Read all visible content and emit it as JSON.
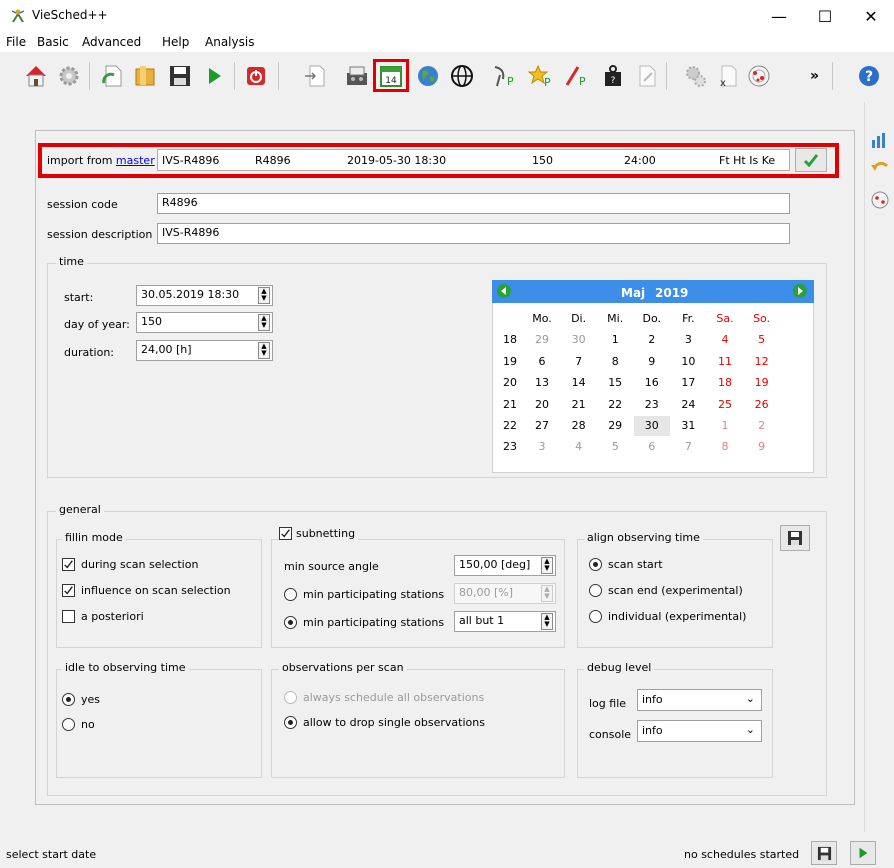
{
  "window": {
    "title": "VieSched++",
    "minimize": "—",
    "maximize": "☐",
    "close": "✕"
  },
  "menu": [
    "File",
    "Basic",
    "Advanced",
    "Help",
    "Analysis"
  ],
  "toolbar": {
    "overflow": "»"
  },
  "import": {
    "label": "import from",
    "link": "master",
    "fields": [
      "IVS-R4896",
      "R4896",
      "2019-05-30 18:30",
      "150",
      "24:00",
      "Ft Ht Is Ke"
    ]
  },
  "session": {
    "code_label": "session code",
    "code_value": "R4896",
    "desc_label": "session description",
    "desc_value": "IVS-R4896"
  },
  "time": {
    "group": "time",
    "start_label": "start:",
    "start_value": "30.05.2019 18:30",
    "doy_label": "day of year:",
    "doy_value": "150",
    "duration_label": "duration:",
    "duration_value": "24,00 [h]"
  },
  "calendar": {
    "month": "Maj",
    "year": "2019",
    "weekdays": [
      "Mo.",
      "Di.",
      "Mi.",
      "Do.",
      "Fr.",
      "Sa.",
      "So."
    ],
    "weeks": [
      "18",
      "19",
      "20",
      "21",
      "22",
      "23"
    ],
    "days": [
      [
        "29",
        "30",
        "1",
        "2",
        "3",
        "4",
        "5"
      ],
      [
        "6",
        "7",
        "8",
        "9",
        "10",
        "11",
        "12"
      ],
      [
        "13",
        "14",
        "15",
        "16",
        "17",
        "18",
        "19"
      ],
      [
        "20",
        "21",
        "22",
        "23",
        "24",
        "25",
        "26"
      ],
      [
        "27",
        "28",
        "29",
        "30",
        "31",
        "1",
        "2"
      ],
      [
        "3",
        "4",
        "5",
        "6",
        "7",
        "8",
        "9"
      ]
    ]
  },
  "general": {
    "group": "general",
    "fillin": {
      "title": "fillin mode",
      "opt1": "during scan selection",
      "opt2": "influence on scan selection",
      "opt3": "a posteriori"
    },
    "subnet": {
      "title": "subnetting",
      "angle_label": "min source angle",
      "angle_value": "150,00 [deg]",
      "min_pct_label": "min participating stations",
      "min_pct_value": "80,00 [%]",
      "min_sta_label": "min participating stations",
      "min_sta_value": "all but 1"
    },
    "align": {
      "title": "align observing time",
      "opt1": "scan start",
      "opt2": "scan end (experimental)",
      "opt3": "individual (experimental)"
    },
    "idle": {
      "title": "idle to observing time",
      "yes": "yes",
      "no": "no"
    },
    "obs": {
      "title": "observations per scan",
      "opt1": "always schedule all observations",
      "opt2": "allow to drop single observations"
    },
    "debug": {
      "title": "debug level",
      "log_label": "log file",
      "log_value": "info",
      "console_label": "console",
      "console_value": "info"
    }
  },
  "status": {
    "left": "select start date",
    "right": "no schedules started"
  }
}
